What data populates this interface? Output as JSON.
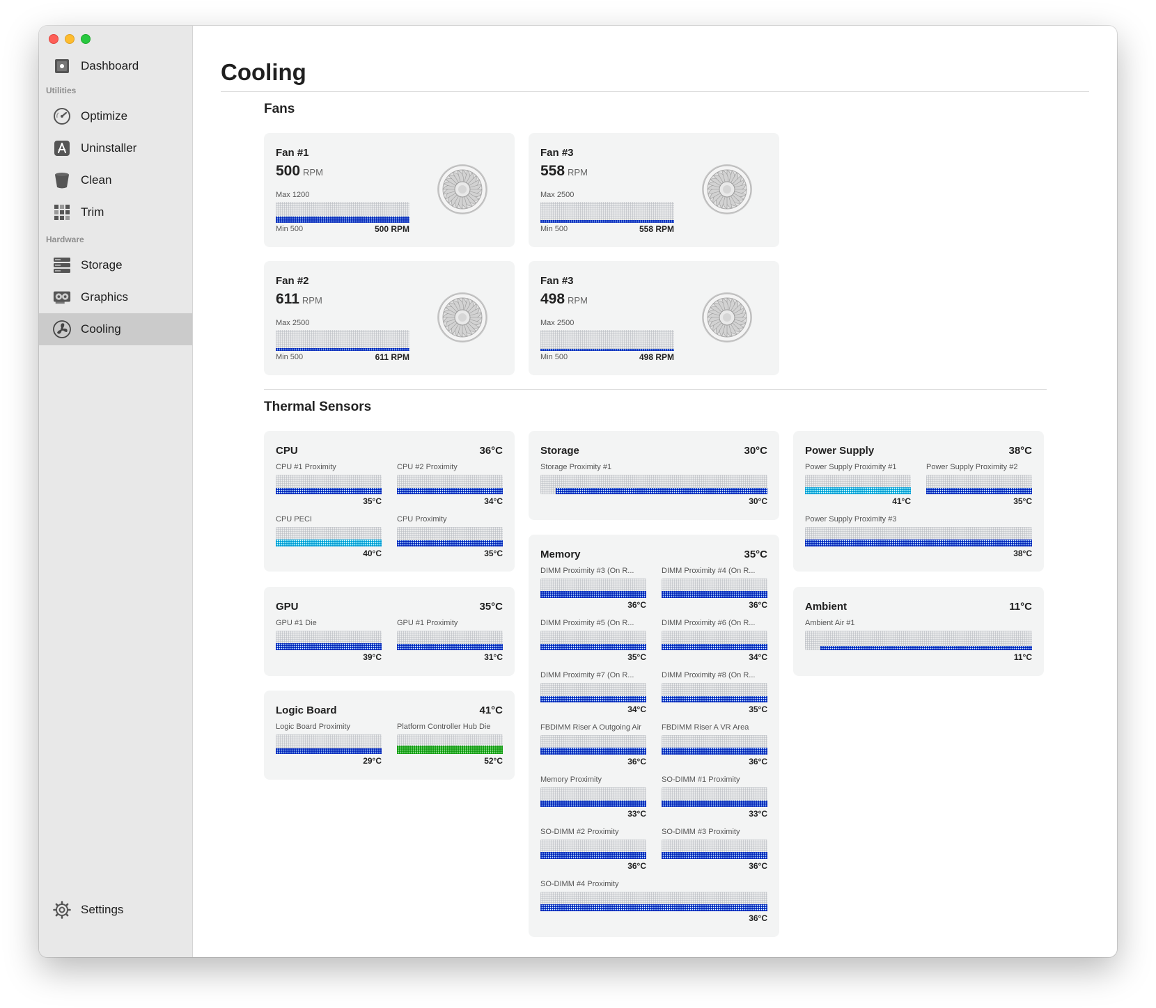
{
  "sidebar": {
    "sections": {
      "utilities": "Utilities",
      "hardware": "Hardware"
    },
    "items": [
      {
        "key": "dashboard",
        "label": "Dashboard",
        "icon": "dashboard-icon"
      },
      {
        "key": "optimize",
        "label": "Optimize",
        "icon": "speedometer-icon"
      },
      {
        "key": "uninstaller",
        "label": "Uninstaller",
        "icon": "app-store-icon"
      },
      {
        "key": "clean",
        "label": "Clean",
        "icon": "trash-icon"
      },
      {
        "key": "trim",
        "label": "Trim",
        "icon": "grid-icon"
      },
      {
        "key": "storage",
        "label": "Storage",
        "icon": "storage-icon"
      },
      {
        "key": "graphics",
        "label": "Graphics",
        "icon": "graphics-card-icon"
      },
      {
        "key": "cooling",
        "label": "Cooling",
        "icon": "fan-icon",
        "active": true
      }
    ],
    "settings": {
      "label": "Settings",
      "icon": "gear-icon"
    }
  },
  "page": {
    "title": "Cooling"
  },
  "fans": {
    "title": "Fans",
    "items": [
      {
        "name": "Fan #1",
        "rpm": "500",
        "unit": "RPM",
        "max": "Max 1200",
        "min": "Min 500",
        "current": "500 RPM",
        "level": 0.3
      },
      {
        "name": "Fan #3",
        "rpm": "558",
        "unit": "RPM",
        "max": "Max 2500",
        "min": "Min 500",
        "current": "558 RPM",
        "level": 0.12
      },
      {
        "name": "Fan #2",
        "rpm": "611",
        "unit": "RPM",
        "max": "Max 2500",
        "min": "Min 500",
        "current": "611 RPM",
        "level": 0.14
      },
      {
        "name": "Fan #3",
        "rpm": "498",
        "unit": "RPM",
        "max": "Max 2500",
        "min": "Min 500",
        "current": "498 RPM",
        "level": 0.1
      }
    ]
  },
  "thermal": {
    "title": "Thermal Sensors",
    "groups": {
      "cpu": {
        "title": "CPU",
        "temp": "36°C",
        "sensors": [
          {
            "label": "CPU #1 Proximity",
            "value": "35°C",
            "level": 0.35
          },
          {
            "label": "CPU #2 Proximity",
            "value": "34°C",
            "level": 0.34
          },
          {
            "label": "CPU PECI",
            "value": "40°C",
            "level": 0.4
          },
          {
            "label": "CPU Proximity",
            "value": "35°C",
            "level": 0.35
          }
        ]
      },
      "gpu": {
        "title": "GPU",
        "temp": "35°C",
        "sensors": [
          {
            "label": "GPU #1 Die",
            "value": "39°C",
            "level": 0.39
          },
          {
            "label": "GPU #1 Proximity",
            "value": "31°C",
            "level": 0.31
          }
        ]
      },
      "logic": {
        "title": "Logic Board",
        "temp": "41°C",
        "sensors": [
          {
            "label": "Logic Board Proximity",
            "value": "29°C",
            "level": 0.29
          },
          {
            "label": "Platform Controller Hub Die",
            "value": "52°C",
            "level": 0.52
          }
        ]
      },
      "storage": {
        "title": "Storage",
        "temp": "30°C",
        "sensors": [
          {
            "label": "Storage Proximity #1",
            "value": "30°C",
            "level": 0.3
          }
        ]
      },
      "memory": {
        "title": "Memory",
        "temp": "35°C",
        "sensors": [
          {
            "label": "DIMM Proximity #3 (On R...",
            "value": "36°C",
            "level": 0.36
          },
          {
            "label": "DIMM Proximity #4 (On R...",
            "value": "36°C",
            "level": 0.36
          },
          {
            "label": "DIMM Proximity #5 (On R...",
            "value": "35°C",
            "level": 0.35
          },
          {
            "label": "DIMM Proximity #6 (On R...",
            "value": "34°C",
            "level": 0.34
          },
          {
            "label": "DIMM Proximity #7 (On R...",
            "value": "34°C",
            "level": 0.34
          },
          {
            "label": "DIMM Proximity #8 (On R...",
            "value": "35°C",
            "level": 0.35
          },
          {
            "label": "FBDIMM Riser A Outgoing Air",
            "value": "36°C",
            "level": 0.36
          },
          {
            "label": "FBDIMM Riser A VR Area",
            "value": "36°C",
            "level": 0.36
          },
          {
            "label": "Memory Proximity",
            "value": "33°C",
            "level": 0.33
          },
          {
            "label": "SO-DIMM #1 Proximity",
            "value": "33°C",
            "level": 0.33
          },
          {
            "label": "SO-DIMM #2 Proximity",
            "value": "36°C",
            "level": 0.36
          },
          {
            "label": "SO-DIMM #3 Proximity",
            "value": "36°C",
            "level": 0.36
          },
          {
            "label": "SO-DIMM #4 Proximity",
            "value": "36°C",
            "level": 0.36
          }
        ]
      },
      "power": {
        "title": "Power Supply",
        "temp": "38°C",
        "sensors": [
          {
            "label": "Power Supply Proximity #1",
            "value": "41°C",
            "level": 0.41
          },
          {
            "label": "Power Supply Proximity #2",
            "value": "35°C",
            "level": 0.35
          },
          {
            "label": "Power Supply Proximity #3",
            "value": "38°C",
            "level": 0.38
          }
        ]
      },
      "ambient": {
        "title": "Ambient",
        "temp": "11°C",
        "sensors": [
          {
            "label": "Ambient Air #1",
            "value": "11°C",
            "level": 0.11
          }
        ]
      }
    }
  },
  "colors": {
    "blue": "#2f63d8",
    "cyan": "#34c6e8",
    "green": "#3cc23c",
    "accent": "#cbcbcb"
  }
}
